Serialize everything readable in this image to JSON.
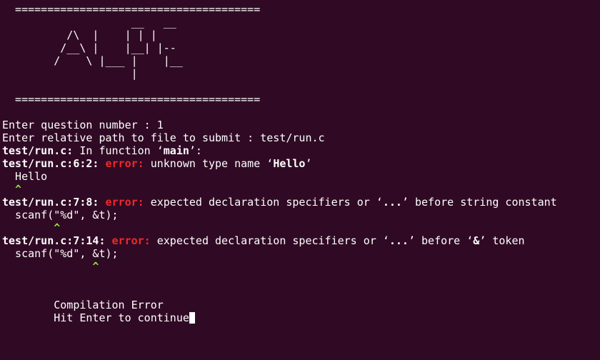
{
  "banner": {
    "rule_top": "  ======================================",
    "art": [
      "                    __   __",
      "          /\\  |    | | |",
      "         /__\\ |    |__| |--",
      "        /    \\ |___ |    |__",
      "                    |"
    ],
    "rule_bottom": "  ======================================"
  },
  "session": {
    "prompt_question": "Enter question number : 1",
    "prompt_path": "Enter relative path to file to submit : test/run.c"
  },
  "compiler": {
    "context": {
      "file": "test/run.c:",
      "text": " In function ‘",
      "func": "main",
      "end": "’:"
    },
    "diagnostics": [
      {
        "location": "test/run.c:6:2:",
        "label": "error:",
        "message_pre": " unknown type name ‘",
        "message_bold": "Hello",
        "message_post": "’",
        "source": "  Hello",
        "caret": "  ^"
      },
      {
        "location": "test/run.c:7:8:",
        "label": "error:",
        "message_pre": " expected declaration specifiers or ‘",
        "message_bold": "...",
        "message_post": "’ before string constant",
        "source": "  scanf(\"%d\", &t);",
        "caret": "        ^"
      },
      {
        "location": "test/run.c:7:14:",
        "label": "error:",
        "message_pre": " expected declaration specifiers or ‘",
        "message_bold": "...",
        "message_post": "’ before ‘",
        "message_bold2": "&",
        "message_post2": "’ token",
        "source": "  scanf(\"%d\", &t);",
        "caret": "              ^"
      }
    ]
  },
  "status": {
    "result": "        Compilation Error",
    "continue_prompt": "        Hit Enter to continue"
  },
  "colors": {
    "background": "#300a24",
    "foreground": "#ffffff",
    "error": "#ef2929",
    "caret": "#8ae234"
  }
}
